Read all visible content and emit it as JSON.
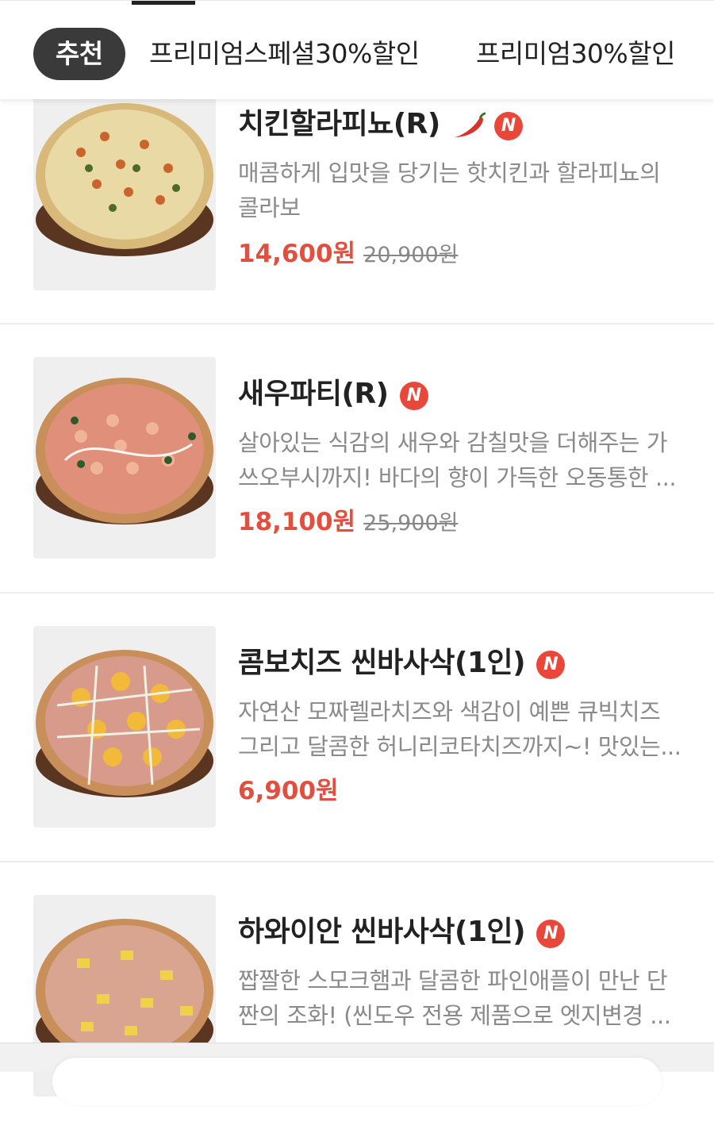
{
  "tabs": [
    {
      "label": "추천",
      "active": true
    },
    {
      "label": "프리미엄스페셜30%할인",
      "active": false
    },
    {
      "label": "프리미엄30%할인",
      "active": false
    }
  ],
  "items": [
    {
      "name": "치킨할라피뇨(R)",
      "spicy": true,
      "is_new": true,
      "badge_new": "N",
      "desc_lines": [
        "매콤하게 입맛을 당기는 핫치킨과 할라피뇨의",
        "콜라보"
      ],
      "price": "14,600원",
      "original_price": "20,900원"
    },
    {
      "name": "새우파티(R)",
      "spicy": false,
      "is_new": true,
      "badge_new": "N",
      "desc_lines": [
        "살아있는 식감의 새우와 감칠맛을 더해주는 가",
        "쓰오부시까지! 바다의 향이 가득한 오동통한 ..."
      ],
      "price": "18,100원",
      "original_price": "25,900원"
    },
    {
      "name": "콤보치즈 씬바사삭(1인)",
      "spicy": false,
      "is_new": true,
      "badge_new": "N",
      "desc_lines": [
        "자연산 모짜렐라치즈와 색감이 예쁜 큐빅치즈",
        "그리고 달콤한 허니리코타치즈까지~! 맛있는..."
      ],
      "price": "6,900원",
      "original_price": ""
    },
    {
      "name": "하와이안 씬바사삭(1인)",
      "spicy": false,
      "is_new": true,
      "badge_new": "N",
      "desc_lines": [
        "짭짤한 스모크햄과 달콤한 파인애플이 만난 단",
        "짠의 조화! (씬도우 전용 제품으로 엣지변경 ..."
      ],
      "price": "",
      "original_price": ""
    }
  ],
  "colors": {
    "accent_price": "#e1503f",
    "new_badge": "#e8473a",
    "active_tab_bg": "#3a3a3a"
  }
}
